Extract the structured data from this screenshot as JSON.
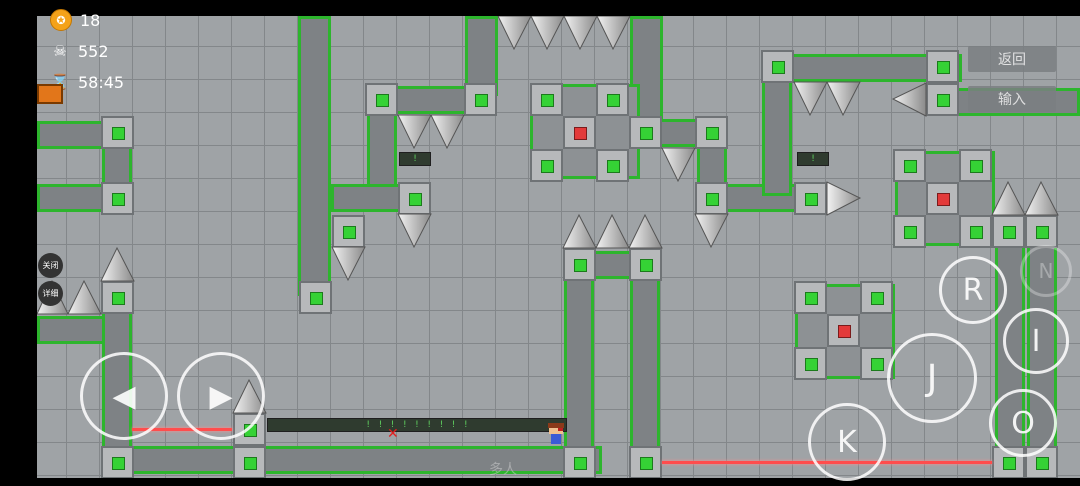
{
  "hud": {
    "coins": "18",
    "deaths": "552",
    "timer": "58:45",
    "coin_icon": "coin-icon",
    "skull_icon": "skull-icon",
    "hourglass_icon": "hourglass-icon"
  },
  "menu": {
    "back_label": "返回",
    "input_label": "输入"
  },
  "side_buttons": {
    "close_label": "关闭",
    "detail_label": "详细"
  },
  "controls": {
    "left_icon": "arrow-left-icon",
    "right_icon": "arrow-right-icon",
    "r_label": "R",
    "n_label": "N",
    "i_label": "I",
    "j_label": "J",
    "k_label": "K",
    "o_label": "O"
  },
  "footer": {
    "multiplayer_label": "多人"
  },
  "colors": {
    "rail_border": "#2db52d",
    "block_light": "#35d235",
    "laser": "#ff4d4d",
    "background": "#9fa3a6"
  }
}
